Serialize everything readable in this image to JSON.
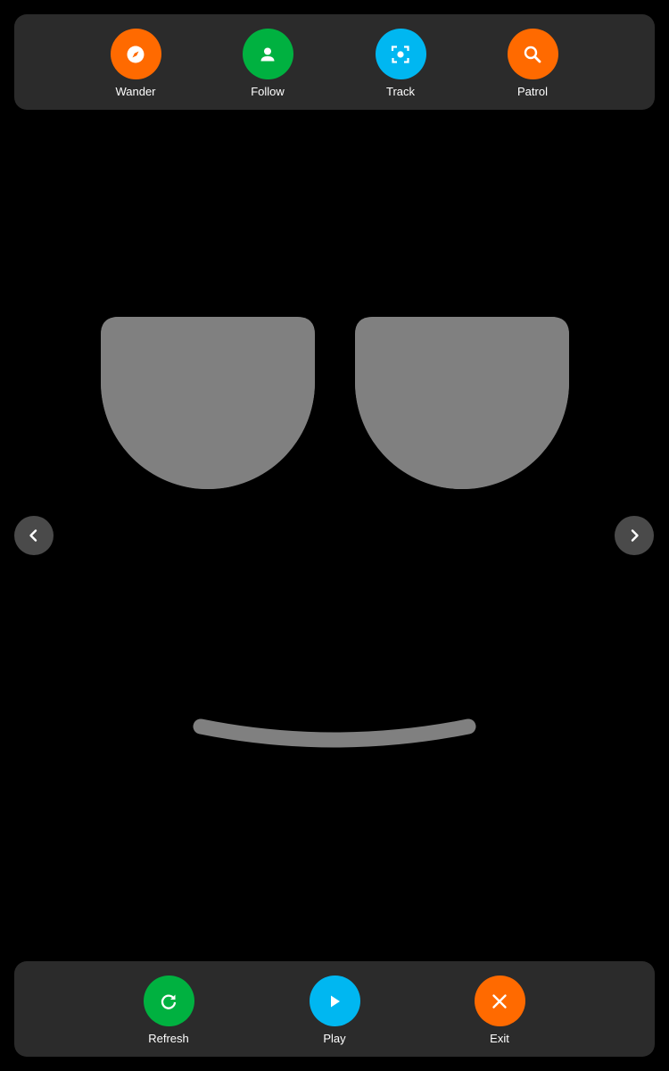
{
  "top_bar": {
    "modes": [
      {
        "label": "Wander",
        "icon": "compass-icon",
        "color": "#ff6a00"
      },
      {
        "label": "Follow",
        "icon": "person-icon",
        "color": "#00b140"
      },
      {
        "label": "Track",
        "icon": "focus-target-icon",
        "color": "#00b7f1"
      },
      {
        "label": "Patrol",
        "icon": "search-icon",
        "color": "#ff6a00"
      }
    ]
  },
  "face": {
    "expression": "sunglasses-smile",
    "feature_color": "#808080"
  },
  "navigation": {
    "prev_icon": "chevron-left-icon",
    "next_icon": "chevron-right-icon"
  },
  "bottom_bar": {
    "actions": [
      {
        "label": "Refresh",
        "icon": "refresh-icon",
        "color": "#00b140"
      },
      {
        "label": "Play",
        "icon": "play-icon",
        "color": "#00b7f1"
      },
      {
        "label": "Exit",
        "icon": "close-icon",
        "color": "#ff6a00"
      }
    ]
  }
}
